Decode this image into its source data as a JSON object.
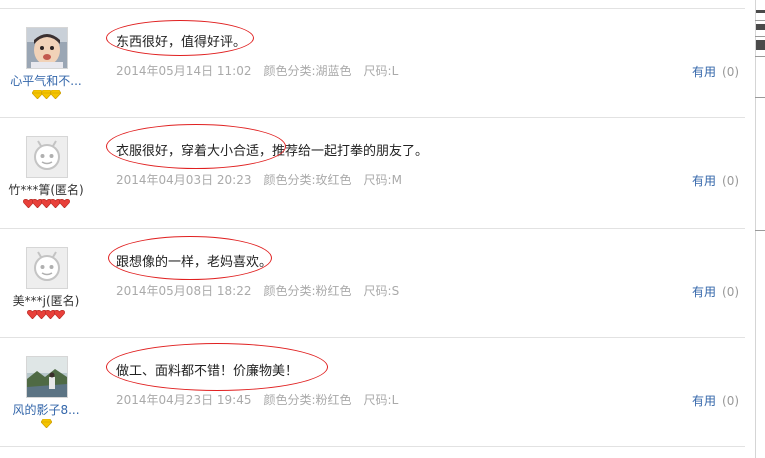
{
  "reviews": [
    {
      "username": "心平气和不...",
      "username_style": "link",
      "avatar": "baby-photo",
      "badge_type": "diamond",
      "badge_count": 3,
      "content": "东西很好，值得好评。",
      "date": "2014年05月14日 11:02",
      "color": "颜色分类:湖蓝色",
      "size": "尺码:L",
      "useful_label": "有用",
      "useful_count": "(0)"
    },
    {
      "username": "竹***箐(匿名)",
      "username_style": "plain",
      "avatar": "default-robot",
      "badge_type": "heart",
      "badge_count": 5,
      "content": "衣服很好，穿着大小合适，推荐给一起打拳的朋友了。",
      "date": "2014年04月03日 20:23",
      "color": "颜色分类:玫红色",
      "size": "尺码:M",
      "useful_label": "有用",
      "useful_count": "(0)"
    },
    {
      "username": "美***j(匿名)",
      "username_style": "plain",
      "avatar": "default-robot",
      "badge_type": "heart",
      "badge_count": 4,
      "content": "跟想像的一样，老妈喜欢。",
      "date": "2014年05月08日 18:22",
      "color": "颜色分类:粉红色",
      "size": "尺码:S",
      "useful_label": "有用",
      "useful_count": "(0)"
    },
    {
      "username": "风的影子8...",
      "username_style": "link",
      "avatar": "landscape-photo",
      "badge_type": "diamond",
      "badge_count": 1,
      "content": "做工、面料都不错！价廉物美！",
      "date": "2014年04月23日 19:45",
      "color": "颜色分类:粉红色",
      "size": "尺码:L",
      "useful_label": "有用",
      "useful_count": "(0)"
    }
  ],
  "colors": {
    "link": "#3366aa",
    "annotation": "#e02020",
    "meta": "#aaaaaa",
    "divider": "#e2e2e2"
  }
}
